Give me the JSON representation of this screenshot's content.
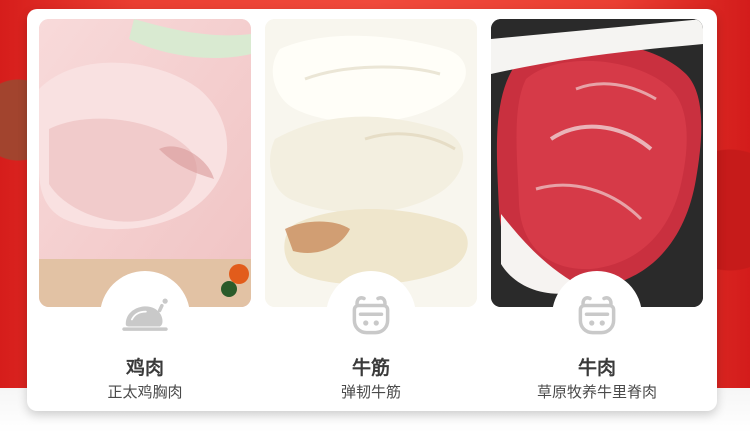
{
  "items": [
    {
      "title": "鸡肉",
      "subtitle": "正太鸡胸肉",
      "icon": "chicken-icon"
    },
    {
      "title": "牛筋",
      "subtitle": "弹韧牛筋",
      "icon": "cow-icon"
    },
    {
      "title": "牛肉",
      "subtitle": "草原牧养牛里脊肉",
      "icon": "cow-icon"
    }
  ],
  "colors": {
    "background_red": "#f04a3c",
    "card": "#ffffff",
    "icon_gray": "#c9c9c9",
    "text_dark": "#3a3a3a"
  }
}
